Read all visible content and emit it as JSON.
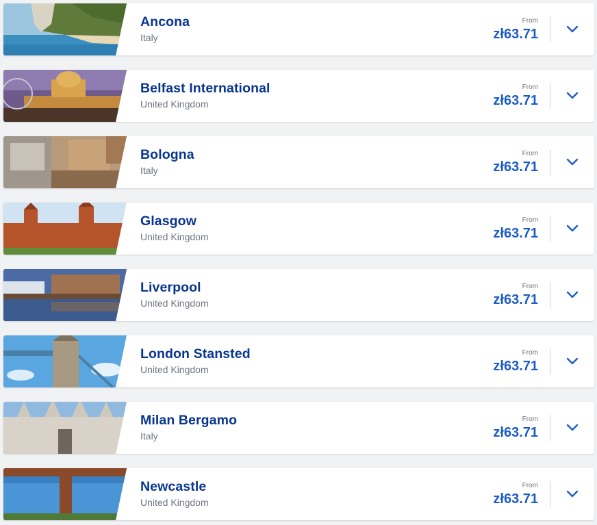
{
  "destinations": [
    {
      "city": "Ancona",
      "country": "Italy",
      "from_label": "From",
      "price": "zł63.71",
      "image": "coastal-cliff-beach"
    },
    {
      "city": "Belfast International",
      "country": "United Kingdom",
      "from_label": "From",
      "price": "zł63.71",
      "image": "city-hall-dome-night"
    },
    {
      "city": "Bologna",
      "country": "Italy",
      "from_label": "From",
      "price": "zł63.71",
      "image": "historic-rooftops"
    },
    {
      "city": "Glasgow",
      "country": "United Kingdom",
      "from_label": "From",
      "price": "zł63.71",
      "image": "red-sandstone-gallery"
    },
    {
      "city": "Liverpool",
      "country": "United Kingdom",
      "from_label": "From",
      "price": "zł63.71",
      "image": "waterfront-reflections"
    },
    {
      "city": "London Stansted",
      "country": "United Kingdom",
      "from_label": "From",
      "price": "zł63.71",
      "image": "tower-bridge"
    },
    {
      "city": "Milan Bergamo",
      "country": "Italy",
      "from_label": "From",
      "price": "zł63.71",
      "image": "gothic-cathedral"
    },
    {
      "city": "Newcastle",
      "country": "United Kingdom",
      "from_label": "From",
      "price": "zł63.71",
      "image": "angel-of-the-north"
    }
  ],
  "colors": {
    "city_text": "#073590",
    "price_text": "#1c5cc7",
    "muted_text": "#6e7680",
    "chevron": "#1c5cc7",
    "background": "#f1f2f4"
  },
  "icons": {
    "expand": "chevron-down-icon"
  }
}
